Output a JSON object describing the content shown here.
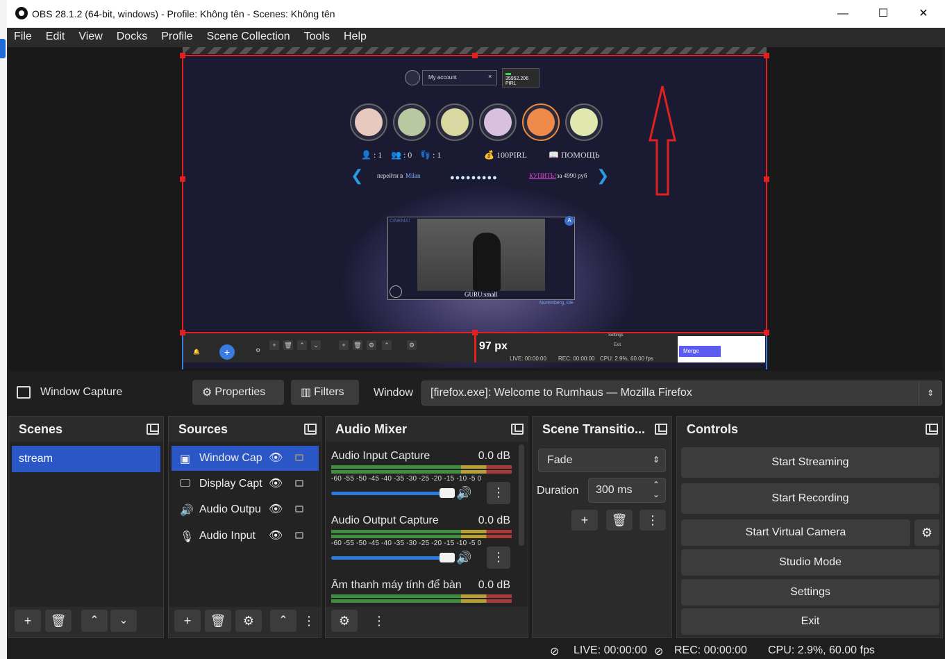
{
  "window": {
    "title": "OBS 28.1.2 (64-bit, windows) - Profile: Không tên - Scenes: Không tên",
    "minimize": "—",
    "maximize": "☐",
    "close": "✕"
  },
  "menu": [
    "File",
    "Edit",
    "View",
    "Docks",
    "Profile",
    "Scene Collection",
    "Tools",
    "Help"
  ],
  "preview": {
    "account_placeholder": "My account",
    "account_close": "×",
    "balance_value": "35952.206",
    "balance_unit": "PIRL",
    "stat_users": "👤 : 1",
    "stat_groups": "👥 : 0",
    "stat_steps": "👣 : 1",
    "stat_pirl": "💰 100PIRL",
    "stat_help": "📖 ПОМОЩЬ",
    "nav_prev": "❮",
    "nav_next": "❯",
    "goto_label": "перейти в",
    "goto_city": "Milan",
    "dots": "●●●●●●●●●",
    "buy_link": "КУПИТЬ!",
    "buy_price": "за 4990 руб",
    "video_cinema": "CINEMA!",
    "video_caption": "GURU:small",
    "video_city": "Nuremberg, DE",
    "video_badge": "A",
    "resize_label": "97 px",
    "mini_live": "LIVE: 00:00:00",
    "mini_rec": "REC: 00:00:00",
    "mini_cpu": "CPU: 2.9%, 60.00 fps",
    "mini_settings": "Settings",
    "mini_exit": "Exit",
    "mini_merge": "Merge"
  },
  "source_toolbar": {
    "source_name": "Window Capture",
    "properties": "Properties",
    "filters": "Filters",
    "window_label": "Window",
    "window_value": "[firefox.exe]: Welcome to Rumhaus — Mozilla Firefox"
  },
  "docks": {
    "scenes": {
      "title": "Scenes",
      "items": [
        "stream"
      ]
    },
    "sources": {
      "title": "Sources",
      "items": [
        {
          "name": "Window Cap",
          "icon": "window-icon"
        },
        {
          "name": "Display Capt",
          "icon": "monitor-icon"
        },
        {
          "name": "Audio Outpu",
          "icon": "speaker-icon"
        },
        {
          "name": "Audio Input",
          "icon": "microphone-icon"
        }
      ]
    },
    "mixer": {
      "title": "Audio Mixer",
      "ticks": "-60 -55 -50 -45 -40 -35 -30 -25 -20 -15 -10  -5   0",
      "channels": [
        {
          "name": "Audio Input Capture",
          "db": "0.0 dB",
          "level": 1.0
        },
        {
          "name": "Audio Output Capture",
          "db": "0.0 dB",
          "level": 1.0
        },
        {
          "name": "Âm thanh máy tính để bàn",
          "db": "0.0 dB",
          "level": 1.0
        }
      ]
    },
    "transitions": {
      "title": "Scene Transitio...",
      "selected": "Fade",
      "duration_label": "Duration",
      "duration_value": "300 ms"
    },
    "controls": {
      "title": "Controls",
      "start_streaming": "Start Streaming",
      "start_recording": "Start Recording",
      "start_virtual_camera": "Start Virtual Camera",
      "studio_mode": "Studio Mode",
      "settings": "Settings",
      "exit": "Exit"
    }
  },
  "status": {
    "live": "LIVE: 00:00:00",
    "rec": "REC: 00:00:00",
    "cpu": "CPU: 2.9%, 60.00 fps"
  },
  "colors": {
    "selection": "#e12020",
    "accent_blue": "#2a56c6",
    "dock_bg": "#2b2b2b"
  }
}
